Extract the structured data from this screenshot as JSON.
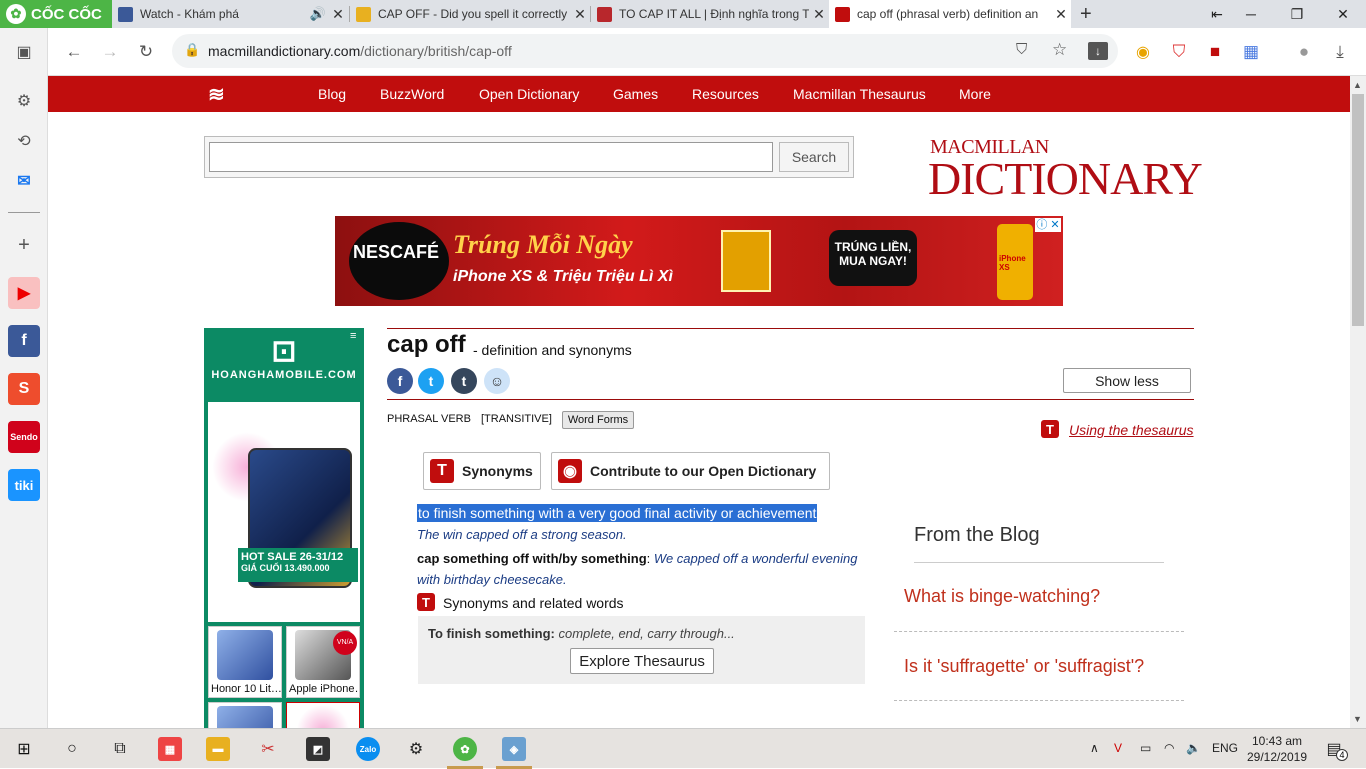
{
  "browser": {
    "logo_text": "CỐC CỐC",
    "tabs": [
      {
        "title": "Watch - Khám phá",
        "favicon": "facebook-icon"
      },
      {
        "title": "CAP OFF - Did you spell it correctly",
        "favicon": "cap-off-icon"
      },
      {
        "title": "TO CAP IT ALL | Định nghĩa trong T",
        "favicon": "cambridge-icon"
      },
      {
        "title": "cap off (phrasal verb) definition an",
        "favicon": "macmillan-icon",
        "active": true
      }
    ],
    "new_tab": "+",
    "url_domain": "macmillandictionary.com",
    "url_path": "/dictionary/british/cap-off"
  },
  "site": {
    "nav": [
      "Blog",
      "BuzzWord",
      "Open Dictionary",
      "Games",
      "Resources",
      "Macmillan Thesaurus",
      "More"
    ],
    "search": {
      "placeholder": "",
      "button": "Search"
    },
    "brand_top": "MACMILLAN",
    "brand_bottom": "DICTIONARY"
  },
  "ad": {
    "brand": "NESCAFÉ",
    "headline": "Trúng Mỗi Ngày",
    "subline": "iPhone XS & Triệu Triệu Lì Xì",
    "cta": "TRÚNG LIỀN, MUA NGAY!",
    "phone_label": "iPhone XS"
  },
  "side_ad": {
    "site": "HOANGHAMOBILE.COM",
    "sale": "HOT SALE 26-31/12",
    "price": "GIÁ CUỐI 13.490.000",
    "thumbs": [
      "Honor 10 Lit…",
      "Apple iPhone…"
    ],
    "badge": "VN/A"
  },
  "entry": {
    "headword": "cap off",
    "subtitle": "- definition and synonyms",
    "show_less": "Show less",
    "part_of_speech": "PHRASAL VERB",
    "grammar": "[TRANSITIVE]",
    "word_forms": "Word Forms",
    "using_thesaurus": "Using the thesaurus",
    "synonyms_btn": "Synonyms",
    "contribute_btn": "Contribute to our Open Dictionary",
    "definition": "to finish something with a very good final activity or achievement",
    "example1": "The win capped off a strong season.",
    "example2_pattern": "cap something off with/by something",
    "example2": "We capped off a wonderful evening with birthday cheesecake.",
    "syn_related": "Synonyms and related words",
    "thes_label": "To finish something:",
    "thes_words": "complete, end, carry through...",
    "explore_btn": "Explore Thesaurus"
  },
  "blog": {
    "title": "From the Blog",
    "links": [
      "What is binge-watching?",
      "Is it 'suffragette' or 'suffragist'?"
    ]
  },
  "taskbar": {
    "lang": "ENG",
    "time": "10:43 am",
    "date": "29/12/2019",
    "notif_count": "4"
  },
  "colors": {
    "brand_red": "#c00d0d",
    "cococ_green": "#4db546",
    "selection_blue": "#2a6fd4",
    "blog_link": "#c0301c"
  }
}
